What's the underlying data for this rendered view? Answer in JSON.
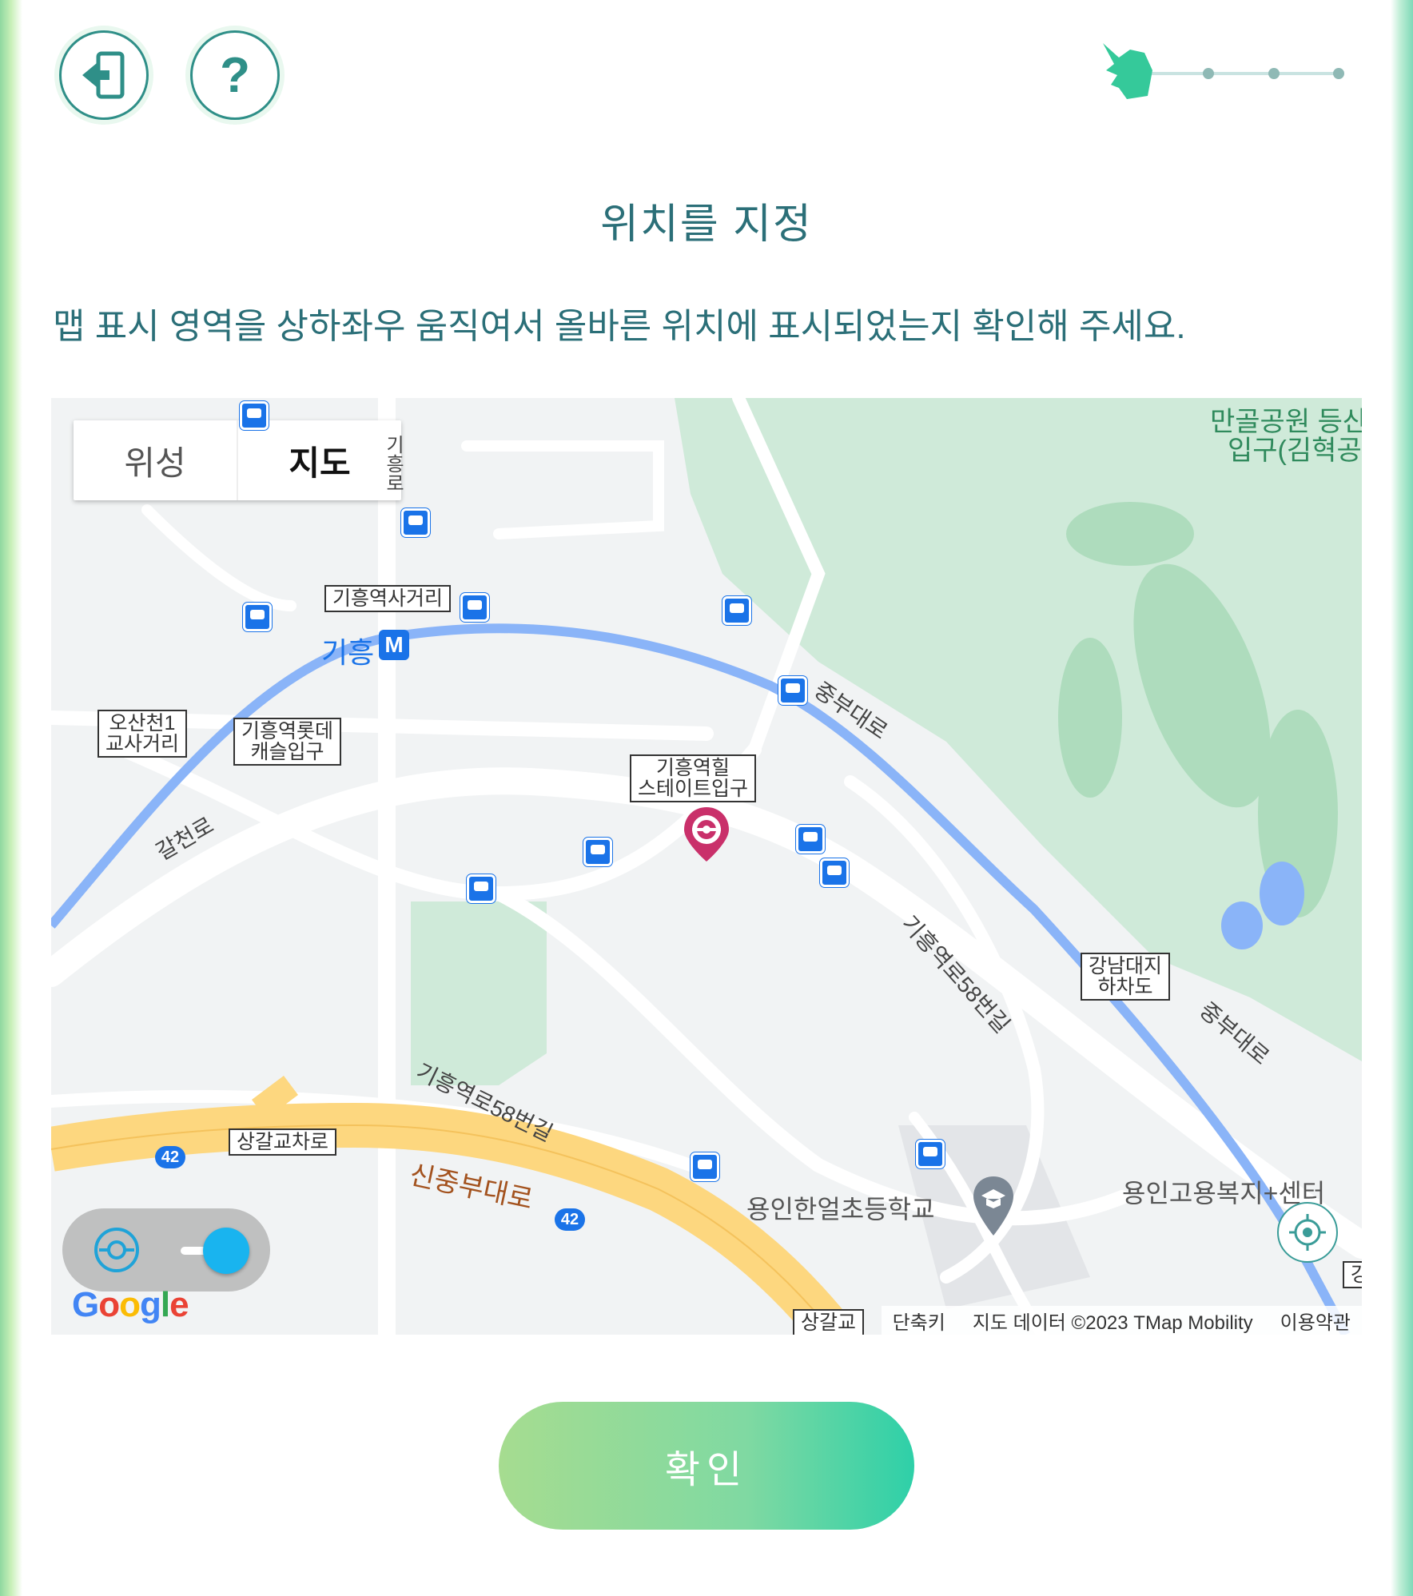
{
  "header": {
    "exit_icon": "exit-icon",
    "help_icon": "question-icon",
    "progress_icon": "pikachu-silhouette-icon",
    "progress_steps": 4,
    "progress_current": 1
  },
  "title": "위치를 지정",
  "description": "맵 표시 영역을 상하좌우 움직여서 올바른 위치에 표시되었는지 확인해 주세요.",
  "map": {
    "type_toggle": {
      "satellite": "위성",
      "map": "지도",
      "selected": "지도"
    },
    "labels": {
      "park_line1": "만골공원 등산",
      "park_line2": "입구(김혁공",
      "station_intersection": "기흥역사거리",
      "station": "기흥",
      "subway_badge": "M",
      "osancheon_line1": "오산천1",
      "osancheon_line2": "교사거리",
      "lotte_line1": "기흥역롯데",
      "lotte_line2": "캐슬입구",
      "hill_line1": "기흥역힐",
      "hill_line2": "스테이트입구",
      "gangnam_line1": "강남대지",
      "gangnam_line2": "하차도",
      "sanggal": "상갈교차로",
      "sanggal_partial": "상갈교",
      "gangnam_partial": "강",
      "jungbu_1": "중부대로",
      "jungbu_2": "중부대로",
      "galcheon": "갈천로",
      "giheungro": "기흥로",
      "giheung58_1": "기흥역로58번길",
      "giheung58_2": "기흥역로58번길",
      "sinjungbu": "신중부대로",
      "route_42": "42",
      "school": "용인한얼초등학교",
      "welfare": "용인고용복지+센터"
    },
    "colors": {
      "water": "#8ab4f8",
      "park": "#cfead9",
      "highway": "#fdd77f",
      "pin": "#c9306a"
    },
    "attribution": {
      "shortcuts": "단축키",
      "data": "지도 데이터 ©2023 TMap Mobility",
      "terms": "이용약관"
    },
    "google_logo": "Google",
    "pin_icon": "pokestop-pin-icon",
    "locate_icon": "my-location-icon",
    "toggle_icon": "pokestop-toggle-icon",
    "toggle_on": true
  },
  "confirm_button": "확인"
}
